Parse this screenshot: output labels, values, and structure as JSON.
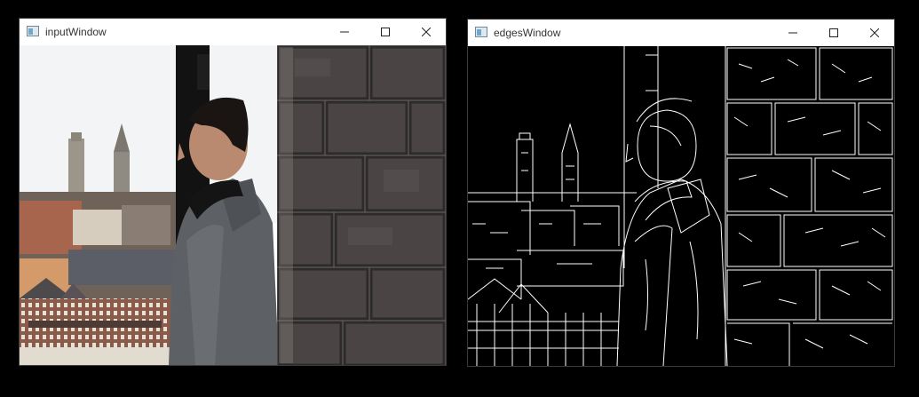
{
  "windows": [
    {
      "title": "inputWindow",
      "icon": "app-window-icon"
    },
    {
      "title": "edgesWindow",
      "icon": "app-window-icon"
    }
  ],
  "controls": {
    "minimize": "minimize-icon",
    "maximize": "maximize-icon",
    "close": "close-icon"
  }
}
